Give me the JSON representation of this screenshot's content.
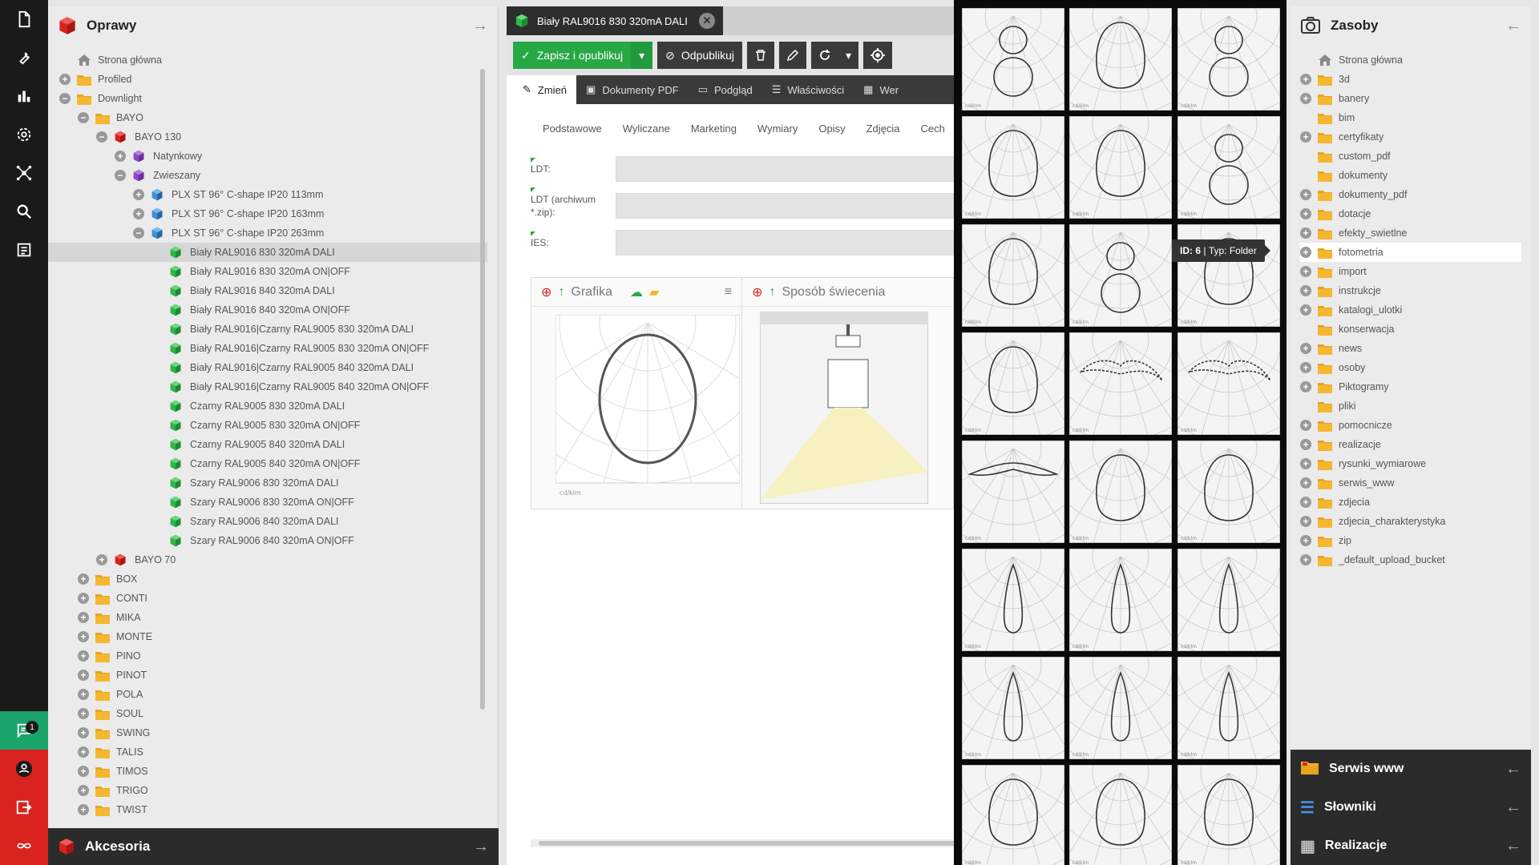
{
  "colors": {
    "accent_green": "#28a745",
    "brand_red": "#d9231f",
    "dark": "#2b2b2b",
    "folder_yellow": "#f5b731"
  },
  "iconbar": {
    "items": [
      "document-icon",
      "wrench-icon",
      "bar-chart-icon",
      "gear-icon",
      "network-icon",
      "search-icon",
      "list-icon"
    ],
    "chat_badge": "1"
  },
  "tree_panel": {
    "title": "Oprawy",
    "footer_title": "Akcesoria",
    "rows": [
      {
        "label": "Strona główna",
        "level": 0,
        "toggle": "",
        "icon": "home"
      },
      {
        "label": "Profiled",
        "level": 0,
        "toggle": "+",
        "icon": "folder"
      },
      {
        "label": "Downlight",
        "level": 0,
        "toggle": "−",
        "icon": "folder"
      },
      {
        "label": "BAYO",
        "level": 1,
        "toggle": "−",
        "icon": "folder"
      },
      {
        "label": "BAYO 130",
        "level": 2,
        "toggle": "−",
        "icon": "cube-red"
      },
      {
        "label": "Natynkowy",
        "level": 3,
        "toggle": "+",
        "icon": "cube-purple"
      },
      {
        "label": "Zwieszany",
        "level": 3,
        "toggle": "−",
        "icon": "cube-purple"
      },
      {
        "label": "PLX ST 96° C-shape IP20 113mm",
        "level": 4,
        "toggle": "+",
        "icon": "cube-blue"
      },
      {
        "label": "PLX ST 96° C-shape IP20 163mm",
        "level": 4,
        "toggle": "+",
        "icon": "cube-blue"
      },
      {
        "label": "PLX ST 96° C-shape IP20 263mm",
        "level": 4,
        "toggle": "−",
        "icon": "cube-blue"
      },
      {
        "label": "Biały RAL9016 830 320mA DALI",
        "level": 5,
        "toggle": "",
        "icon": "cube-green",
        "selected": true
      },
      {
        "label": "Biały RAL9016 830 320mA ON|OFF",
        "level": 5,
        "toggle": "",
        "icon": "cube-green"
      },
      {
        "label": "Biały RAL9016 840 320mA DALI",
        "level": 5,
        "toggle": "",
        "icon": "cube-green"
      },
      {
        "label": "Biały RAL9016 840 320mA ON|OFF",
        "level": 5,
        "toggle": "",
        "icon": "cube-green"
      },
      {
        "label": "Biały RAL9016|Czarny RAL9005 830 320mA DALI",
        "level": 5,
        "toggle": "",
        "icon": "cube-green"
      },
      {
        "label": "Biały RAL9016|Czarny RAL9005 830 320mA ON|OFF",
        "level": 5,
        "toggle": "",
        "icon": "cube-green"
      },
      {
        "label": "Biały RAL9016|Czarny RAL9005 840 320mA DALI",
        "level": 5,
        "toggle": "",
        "icon": "cube-green"
      },
      {
        "label": "Biały RAL9016|Czarny RAL9005 840 320mA ON|OFF",
        "level": 5,
        "toggle": "",
        "icon": "cube-green"
      },
      {
        "label": "Czarny RAL9005 830 320mA DALI",
        "level": 5,
        "toggle": "",
        "icon": "cube-green"
      },
      {
        "label": "Czarny RAL9005 830 320mA ON|OFF",
        "level": 5,
        "toggle": "",
        "icon": "cube-green"
      },
      {
        "label": "Czarny RAL9005 840 320mA DALI",
        "level": 5,
        "toggle": "",
        "icon": "cube-green"
      },
      {
        "label": "Czarny RAL9005 840 320mA ON|OFF",
        "level": 5,
        "toggle": "",
        "icon": "cube-green"
      },
      {
        "label": "Szary RAL9006 830 320mA DALI",
        "level": 5,
        "toggle": "",
        "icon": "cube-green"
      },
      {
        "label": "Szary RAL9006 830 320mA ON|OFF",
        "level": 5,
        "toggle": "",
        "icon": "cube-green"
      },
      {
        "label": "Szary RAL9006 840 320mA DALI",
        "level": 5,
        "toggle": "",
        "icon": "cube-green"
      },
      {
        "label": "Szary RAL9006 840 320mA ON|OFF",
        "level": 5,
        "toggle": "",
        "icon": "cube-green"
      },
      {
        "label": "BAYO 70",
        "level": 2,
        "toggle": "+",
        "icon": "cube-red"
      },
      {
        "label": "BOX",
        "level": 1,
        "toggle": "+",
        "icon": "folder"
      },
      {
        "label": "CONTI",
        "level": 1,
        "toggle": "+",
        "icon": "folder"
      },
      {
        "label": "MIKA",
        "level": 1,
        "toggle": "+",
        "icon": "folder"
      },
      {
        "label": "MONTE",
        "level": 1,
        "toggle": "+",
        "icon": "folder"
      },
      {
        "label": "PINO",
        "level": 1,
        "toggle": "+",
        "icon": "folder"
      },
      {
        "label": "PINOT",
        "level": 1,
        "toggle": "+",
        "icon": "folder"
      },
      {
        "label": "POLA",
        "level": 1,
        "toggle": "+",
        "icon": "folder"
      },
      {
        "label": "SOUL",
        "level": 1,
        "toggle": "+",
        "icon": "folder"
      },
      {
        "label": "SWING",
        "level": 1,
        "toggle": "+",
        "icon": "folder"
      },
      {
        "label": "TALIS",
        "level": 1,
        "toggle": "+",
        "icon": "folder"
      },
      {
        "label": "TIMOS",
        "level": 1,
        "toggle": "+",
        "icon": "folder"
      },
      {
        "label": "TRIGO",
        "level": 1,
        "toggle": "+",
        "icon": "folder"
      },
      {
        "label": "TWIST",
        "level": 1,
        "toggle": "+",
        "icon": "folder"
      }
    ]
  },
  "editor": {
    "doc_tab_title": "Biały RAL9016 830 320mA DALI",
    "toolbar": {
      "publish": "Zapisz i opublikuj",
      "unpublish": "Odpublikuj"
    },
    "tabs": [
      "Zmień",
      "Dokumenty PDF",
      "Podgląd",
      "Właściwości",
      "Wer"
    ],
    "sub_tabs": [
      "Podstawowe",
      "Wyliczane",
      "Marketing",
      "Wymiary",
      "Opisy",
      "Zdjęcia",
      "Cech"
    ],
    "fields": [
      {
        "label": "LDT:"
      },
      {
        "label": "LDT (archiwum *.zip):"
      },
      {
        "label": "IES:"
      }
    ],
    "cards": {
      "graphic": "Grafika",
      "lighting": "Sposób świecenia"
    }
  },
  "grid": {
    "tooltip_id": "ID: 6",
    "tooltip_type": "Typ: Folder",
    "shapes": [
      "butterfly",
      "oval",
      "butterfly",
      "oval",
      "oval",
      "butterfly",
      "oval",
      "butterfly",
      "oval",
      "oval",
      "wing",
      "wing",
      "bat",
      "oval",
      "oval",
      "narrow",
      "narrow",
      "narrow",
      "narrow",
      "narrow",
      "narrow",
      "oval",
      "oval",
      "oval"
    ]
  },
  "assets_panel": {
    "title": "Zasoby",
    "rows": [
      {
        "label": "Strona główna",
        "toggle": "",
        "icon": "home"
      },
      {
        "label": "3d",
        "toggle": "+",
        "icon": "folder"
      },
      {
        "label": "banery",
        "toggle": "+",
        "icon": "folder"
      },
      {
        "label": "bim",
        "toggle": "",
        "icon": "folder"
      },
      {
        "label": "certyfikaty",
        "toggle": "+",
        "icon": "folder"
      },
      {
        "label": "custom_pdf",
        "toggle": "",
        "icon": "folder"
      },
      {
        "label": "dokumenty",
        "toggle": "",
        "icon": "folder"
      },
      {
        "label": "dokumenty_pdf",
        "toggle": "+",
        "icon": "folder"
      },
      {
        "label": "dotacje",
        "toggle": "+",
        "icon": "folder"
      },
      {
        "label": "efekty_swietlne",
        "toggle": "+",
        "icon": "folder"
      },
      {
        "label": "fotometria",
        "toggle": "+",
        "icon": "folder",
        "selected": true
      },
      {
        "label": "import",
        "toggle": "+",
        "icon": "folder"
      },
      {
        "label": "instrukcje",
        "toggle": "+",
        "icon": "folder"
      },
      {
        "label": "katalogi_ulotki",
        "toggle": "+",
        "icon": "folder"
      },
      {
        "label": "konserwacja",
        "toggle": "",
        "icon": "folder"
      },
      {
        "label": "news",
        "toggle": "+",
        "icon": "folder"
      },
      {
        "label": "osoby",
        "toggle": "+",
        "icon": "folder"
      },
      {
        "label": "Piktogramy",
        "toggle": "+",
        "icon": "folder"
      },
      {
        "label": "pliki",
        "toggle": "",
        "icon": "folder"
      },
      {
        "label": "pomocnicze",
        "toggle": "+",
        "icon": "folder"
      },
      {
        "label": "realizacje",
        "toggle": "+",
        "icon": "folder"
      },
      {
        "label": "rysunki_wymiarowe",
        "toggle": "+",
        "icon": "folder"
      },
      {
        "label": "serwis_www",
        "toggle": "+",
        "icon": "folder"
      },
      {
        "label": "zdjecia",
        "toggle": "+",
        "icon": "folder"
      },
      {
        "label": "zdjecia_charakterystyka",
        "toggle": "+",
        "icon": "folder"
      },
      {
        "label": "zip",
        "toggle": "+",
        "icon": "folder"
      },
      {
        "label": "_default_upload_bucket",
        "toggle": "+",
        "icon": "folder"
      }
    ],
    "bottom_bars": [
      "Serwis www",
      "Słowniki",
      "Realizacje"
    ]
  }
}
